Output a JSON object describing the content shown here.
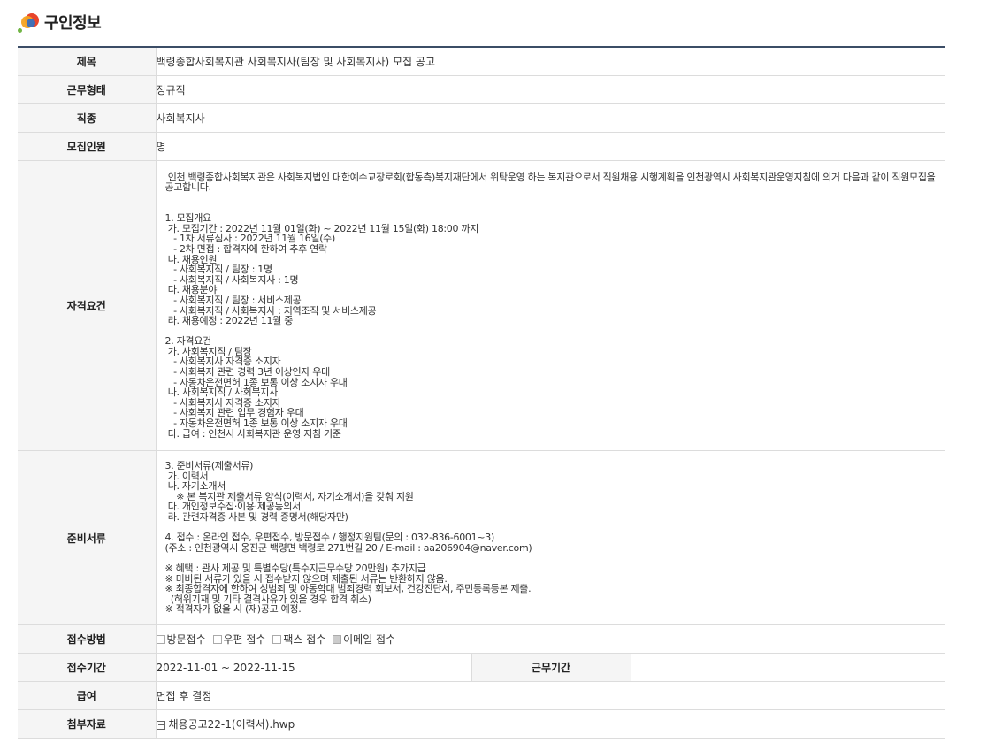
{
  "header": {
    "title": "구인정보",
    "logo_icon": "colorful-circles-logo"
  },
  "rows": {
    "title": {
      "label": "제목",
      "value": "백령종합사회복지관 사회복지사(팀장 및 사회복지사) 모집 공고"
    },
    "employment_type": {
      "label": "근무형태",
      "value": "정규직"
    },
    "job_type": {
      "label": "직종",
      "value": "사회복지사"
    },
    "recruit_count": {
      "label": "모집인원",
      "value": "명"
    },
    "qualification": {
      "label": "자격요건",
      "value": " 인천 백령종합사회복지관은 사회복지법인 대한예수교장로회(합동측)복지재단에서 위탁운영 하는 복지관으로서 직원채용 시행계획을 인천광역시 사회복지관운영지침에 의거 다음과 같이 직원모집을 공고합니다.\n\n\n1. 모집개요\n 가. 모집기간 : 2022년 11월 01일(화) ~ 2022년 11월 15일(화) 18:00 까지\n   - 1차 서류심사 : 2022년 11월 16일(수)\n   - 2차 면접 : 합격자에 한하여 추후 연락\n 나. 채용인원\n   - 사회복지직 / 팀장 : 1명\n   - 사회복지직 / 사회복지사 : 1명\n 다. 채용분야\n   - 사회복지직 / 팀장 : 서비스제공\n   - 사회복지직 / 사회복지사 : 지역조직 및 서비스제공\n 라. 채용예정 : 2022년 11월 중\n\n2. 자격요건\n 가. 사회복지직 / 팀장\n   - 사회복지사 자격증 소지자\n   - 사회복지 관련 경력 3년 이상인자 우대\n   - 자동차운전면허 1종 보통 이상 소지자 우대\n 나. 사회복지직 / 사회복지사\n   - 사회복지사 자격증 소지자\n   - 사회복지 관련 업무 경험자 우대\n   - 자동차운전면허 1종 보통 이상 소지자 우대\n 다. 급여 : 인천시 사회복지관 운영 지침 기준"
    },
    "documents": {
      "label": "준비서류",
      "value": "3. 준비서류(제출서류)\n 가. 이력서\n 나. 자기소개서\n    ※ 본 복지관 제출서류 양식(이력서, 자기소개서)을 갖춰 지원\n 다. 개인정보수집·이용·제공동의서\n 라. 관련자격증 사본 및 경력 증명서(해당자만)\n\n4. 접수 : 온라인 접수, 우편접수, 방문접수 / 행정지원팀(문의 : 032-836-6001~3)\n(주소 : 인천광역시 옹진군 백령면 백령로 271번길 20 / E-mail : aa206904@naver.com)\n\n※ 혜택 : 관사 제공 및 특별수당(특수지근무수당 20만원) 추가지급\n※ 미비된 서류가 있을 시 접수받지 않으며 제출된 서류는 반환하지 않음.\n※ 최종합격자에 한하여 성범죄 및 아동학대 범죄경력 회보서, 건강진단서, 주민등록등본 제출.\n  (허위기재 및 기타 결격사유가 있을 경우 합격 취소)\n※ 적격자가 없을 시 (재)공고 예정."
    },
    "apply_method": {
      "label": "접수방법",
      "options": [
        {
          "label": "방문접수",
          "checked": false
        },
        {
          "label": "우편 접수",
          "checked": false
        },
        {
          "label": "팩스 접수",
          "checked": false
        },
        {
          "label": "이메일 접수",
          "checked": true
        }
      ]
    },
    "apply_period": {
      "label": "접수기간",
      "value": "2022-11-01 ~ 2022-11-15",
      "work_label": "근무기간",
      "work_value": ""
    },
    "salary": {
      "label": "급여",
      "value": "면접 후 결정"
    },
    "attachment": {
      "label": "첨부자료",
      "value": "채용공고22-1(이력서).hwp",
      "icon": "file-icon"
    }
  }
}
